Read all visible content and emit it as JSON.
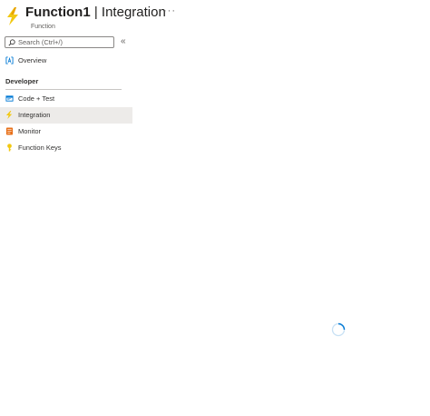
{
  "header": {
    "resource_name": "Function1",
    "separator": "|",
    "blade_name": "Integration",
    "more_label": "···",
    "subtitle": "Function"
  },
  "search": {
    "placeholder": "Search (Ctrl+/)",
    "value": ""
  },
  "collapse_label": "«",
  "nav": {
    "overview": "Overview",
    "section_developer": "Developer",
    "items": [
      {
        "label": "Code + Test",
        "icon": "code-icon"
      },
      {
        "label": "Integration",
        "icon": "bolt-icon",
        "active": true
      },
      {
        "label": "Monitor",
        "icon": "monitor-icon"
      },
      {
        "label": "Function Keys",
        "icon": "key-icon"
      }
    ]
  },
  "colors": {
    "accent": "#0078d4",
    "bolt": "#f2c811",
    "active_bg": "#edebe9"
  }
}
